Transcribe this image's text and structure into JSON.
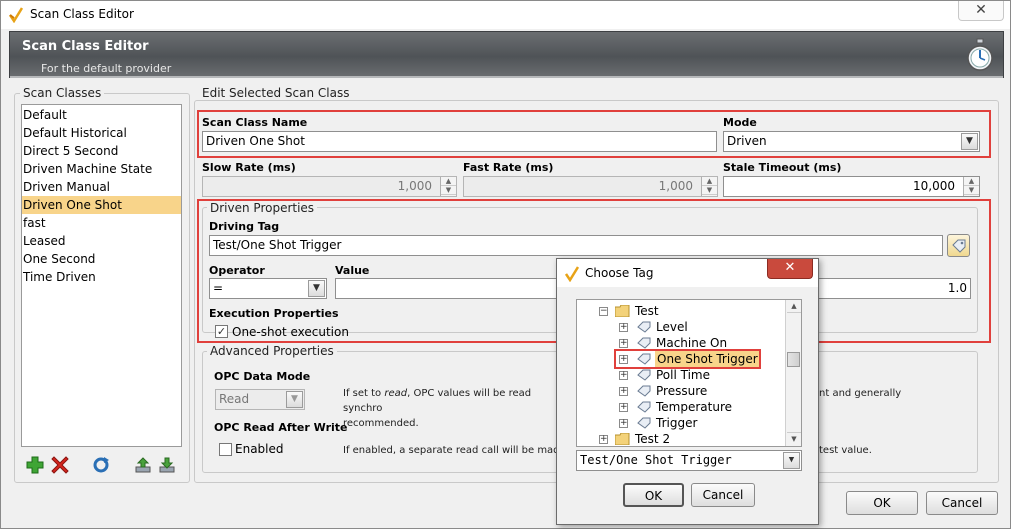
{
  "window": {
    "title": "Scan Class Editor"
  },
  "banner": {
    "title": "Scan Class Editor",
    "subtitle": "For the default provider"
  },
  "scan_classes": {
    "legend": "Scan Classes",
    "items": [
      "Default",
      "Default Historical",
      "Direct 5 Second",
      "Driven Machine State",
      "Driven Manual",
      "Driven One Shot",
      "fast",
      "Leased",
      "One Second",
      "Time Driven"
    ],
    "selected": "Driven One Shot"
  },
  "edit": {
    "legend": "Edit Selected Scan Class",
    "name_label": "Scan Class Name",
    "name_value": "Driven One Shot",
    "mode_label": "Mode",
    "mode_value": "Driven",
    "slow_label": "Slow Rate (ms)",
    "slow_value": "1,000",
    "fast_label": "Fast Rate (ms)",
    "fast_value": "1,000",
    "stale_label": "Stale Timeout (ms)",
    "stale_value": "10,000"
  },
  "driven": {
    "legend": "Driven Properties",
    "tag_label": "Driving Tag",
    "tag_value": "Test/One Shot Trigger",
    "operator_label": "Operator",
    "operator_value": "=",
    "value_label": "Value",
    "value_value": "1.0",
    "exec_label": "Execution Properties",
    "oneshot_label": "One-shot execution"
  },
  "advanced": {
    "legend": "Advanced Properties",
    "opc_mode_label": "OPC Data Mode",
    "opc_mode_value": "Read",
    "opc_mode_desc_a": "If set to",
    "opc_mode_desc_em": "read",
    "opc_mode_desc_b": ", OPC values will be read synchro",
    "opc_mode_desc_c": "nt and generally",
    "opc_mode_desc_d": "recommended.",
    "raw_label": "OPC Read After Write",
    "enabled_label": "Enabled",
    "raw_desc_a": "If enabled, a separate read call will be made",
    "raw_desc_b": "test value."
  },
  "buttons": {
    "ok": "OK",
    "cancel": "Cancel"
  },
  "choose_tag": {
    "title": "Choose Tag",
    "tree": {
      "folder": "Test",
      "children": [
        "Level",
        "Machine On",
        "One Shot Trigger",
        "Poll Time",
        "Pressure",
        "Temperature",
        "Trigger"
      ],
      "selected": "One Shot Trigger",
      "sibling": "Test 2"
    },
    "path_value": "Test/One Shot Trigger",
    "ok": "OK",
    "cancel": "Cancel"
  },
  "colors": {
    "highlight": "#e0403c",
    "selection": "#f8d48a",
    "banner": "#4f5357"
  }
}
